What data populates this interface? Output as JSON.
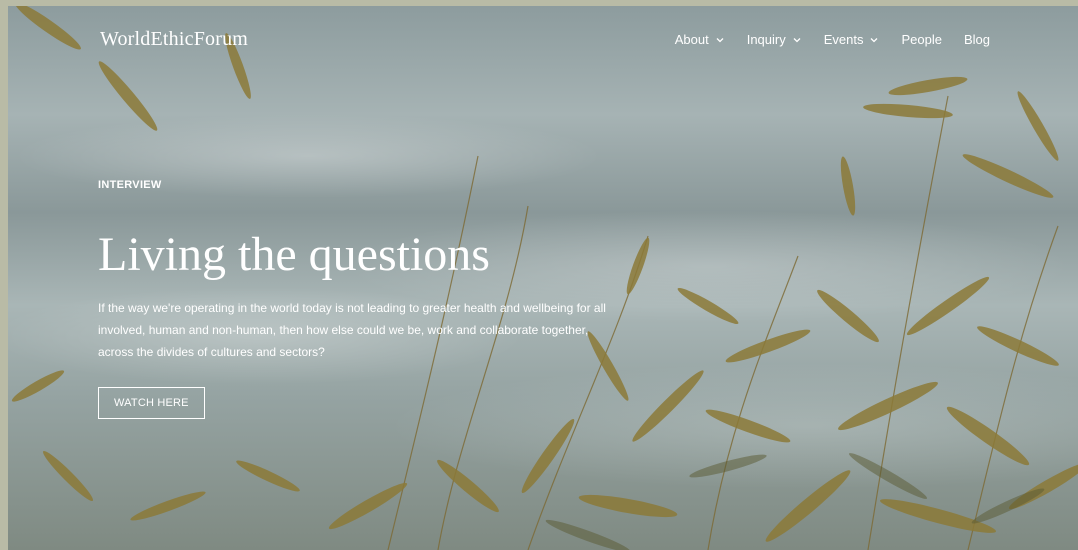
{
  "brand": {
    "name": "WorldEthicForum"
  },
  "nav": {
    "items": [
      {
        "label": "About",
        "has_dropdown": true
      },
      {
        "label": "Inquiry",
        "has_dropdown": true
      },
      {
        "label": "Events",
        "has_dropdown": true
      },
      {
        "label": "People",
        "has_dropdown": false
      },
      {
        "label": "Blog",
        "has_dropdown": false
      }
    ]
  },
  "hero": {
    "eyebrow": "INTERVIEW",
    "title": "Living the questions",
    "description": "If the way we're operating in the world today is not leading to greater health and wellbeing for all involved, human and non-human, then how else could we be, work and collaborate together, across the divides of cultures and sectors?",
    "cta_label": "WATCH HERE"
  },
  "colors": {
    "text": "#ffffff",
    "leaf": "#8a7a3a",
    "sky": "#9eadae"
  }
}
